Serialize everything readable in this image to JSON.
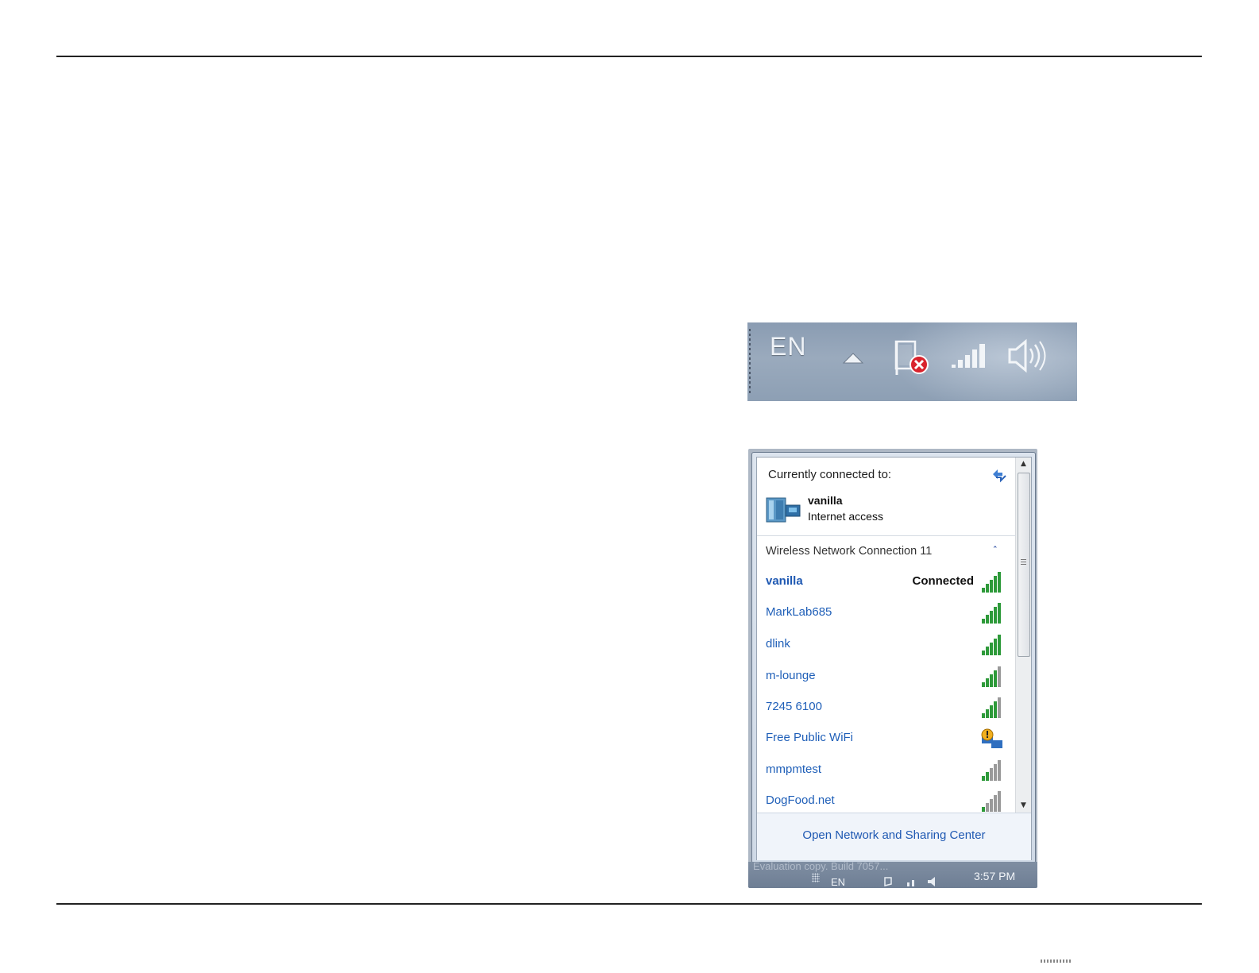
{
  "tray": {
    "language": "EN",
    "icons": [
      "show-hidden-icons-arrow",
      "action-center-flag-error-icon",
      "wireless-signal-icon",
      "volume-icon"
    ]
  },
  "popup": {
    "currently_connected_label": "Currently connected to:",
    "current_network": {
      "name": "vanilla",
      "status": "Internet access",
      "icon": "network-computer-icon"
    },
    "group": {
      "label": "Wireless Network Connection 11",
      "collapse_icon": "chevron-up-icon"
    },
    "networks": [
      {
        "name": "vanilla",
        "status": "Connected",
        "signal": 5,
        "icon": "signal-bars-icon"
      },
      {
        "name": "MarkLab685",
        "status": "",
        "signal": 5,
        "icon": "signal-bars-icon"
      },
      {
        "name": "dlink",
        "status": "",
        "signal": 5,
        "icon": "signal-bars-icon"
      },
      {
        "name": "m-lounge",
        "status": "",
        "signal": 4,
        "icon": "signal-bars-icon"
      },
      {
        "name": "7245 6100",
        "status": "",
        "signal": 4,
        "icon": "signal-bars-icon"
      },
      {
        "name": "Free Public WiFi",
        "status": "",
        "signal": 0,
        "icon": "adhoc-network-warning-icon"
      },
      {
        "name": "mmpmtest",
        "status": "",
        "signal": 2,
        "icon": "signal-bars-icon"
      },
      {
        "name": "DogFood.net",
        "status": "",
        "signal": 1,
        "icon": "signal-bars-icon"
      }
    ],
    "footer_link": "Open Network and Sharing Center"
  },
  "taskbar": {
    "ghost_text": "Evaluation copy. Build 7057...",
    "language": "EN",
    "clock": "3:57 PM"
  },
  "colors": {
    "link_blue": "#1f5fb8",
    "signal_green": "#2e9a3a",
    "signal_gray": "#9a9a9a"
  }
}
